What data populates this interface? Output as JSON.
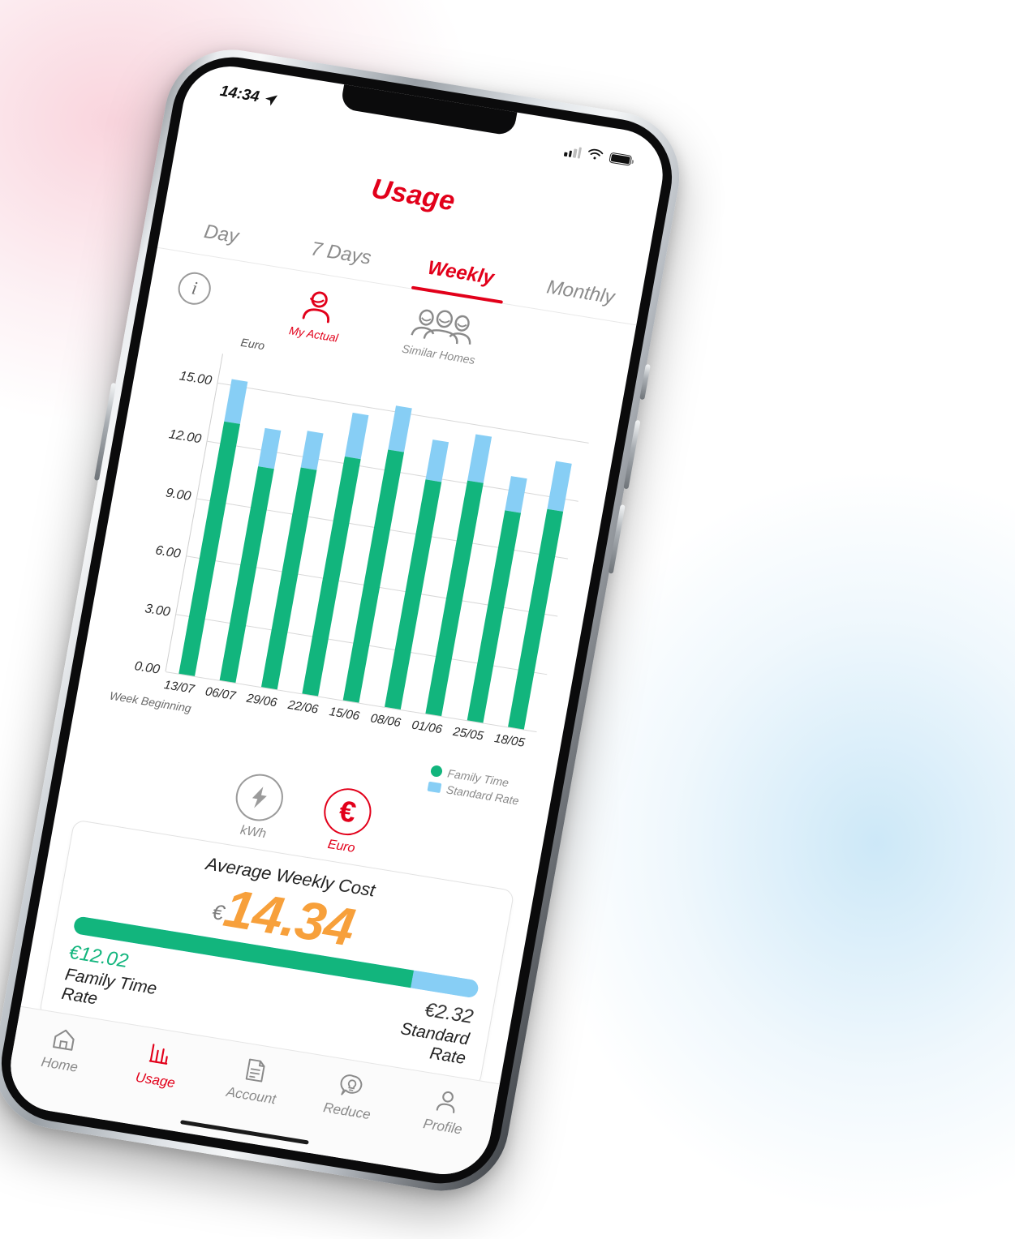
{
  "status_bar": {
    "time": "14:34",
    "location_icon": "location-arrow-icon",
    "signal_icon": "cellular-signal-icon",
    "wifi_icon": "wifi-icon",
    "battery_icon": "battery-icon"
  },
  "header": {
    "title": "Usage"
  },
  "tabs": [
    {
      "label": "Day",
      "active": false
    },
    {
      "label": "7 Days",
      "active": false
    },
    {
      "label": "Weekly",
      "active": true
    },
    {
      "label": "Monthly",
      "active": false
    }
  ],
  "mode_row": {
    "info_label": "i",
    "my_actual": {
      "label": "My Actual",
      "icon": "single-person-icon",
      "selected": true
    },
    "similar_homes": {
      "label": "Similar Homes",
      "icon": "group-people-icon",
      "selected": false
    }
  },
  "chart_data": {
    "type": "bar",
    "title": "",
    "unit_label": "Euro",
    "xlabel": "Week Beginning",
    "ylabel": "Euro",
    "categories": [
      "13/07",
      "06/07",
      "29/06",
      "22/06",
      "15/06",
      "08/06",
      "01/06",
      "25/05",
      "18/05"
    ],
    "ytick_labels": [
      "15.00",
      "12.00",
      "9.00",
      "6.00",
      "3.00",
      "0.00"
    ],
    "ylim": [
      0,
      16.5
    ],
    "grid": true,
    "stacked": true,
    "legend_position": "bottom-right",
    "series": [
      {
        "name": "Family Time",
        "color": "#12B57D",
        "values": [
          13.1,
          11.1,
          11.4,
          12.3,
          13.0,
          11.8,
          12.1,
          10.9,
          11.3
        ]
      },
      {
        "name": "Standard Rate",
        "color": "#87CEF5",
        "values": [
          2.2,
          2.0,
          1.9,
          2.3,
          2.3,
          2.1,
          2.4,
          1.8,
          2.5
        ]
      }
    ],
    "totals": [
      15.3,
      13.1,
      13.3,
      14.6,
      15.3,
      13.9,
      14.5,
      12.7,
      13.8
    ]
  },
  "legend": [
    {
      "label": "Family Time",
      "shape": "dot",
      "color": "#12B57D"
    },
    {
      "label": "Standard Rate",
      "shape": "square",
      "color": "#87CEF5"
    }
  ],
  "unit_toggle": [
    {
      "label": "kWh",
      "icon": "lightning-bolt-icon",
      "selected": false
    },
    {
      "label": "Euro",
      "icon": "euro-symbol-icon",
      "selected": true
    }
  ],
  "summary": {
    "title": "Average Weekly Cost",
    "currency": "€",
    "amount": "14.34",
    "split_green_percent": 83.8,
    "left": {
      "amount": "€12.02",
      "name": "Family Time\nRate"
    },
    "right": {
      "amount": "€2.32",
      "name": "Standard\nRate"
    }
  },
  "bottom_nav": [
    {
      "label": "Home",
      "icon": "home-icon",
      "active": false
    },
    {
      "label": "Usage",
      "icon": "bar-chart-icon",
      "active": true
    },
    {
      "label": "Account",
      "icon": "document-icon",
      "active": false
    },
    {
      "label": "Reduce",
      "icon": "lightbulb-speech-bubble-icon",
      "active": false
    },
    {
      "label": "Profile",
      "icon": "person-icon",
      "active": false
    }
  ],
  "colors": {
    "brand_red": "#E2001A",
    "green": "#12B57D",
    "blue": "#87CEF5",
    "orange": "#F7A03B"
  }
}
